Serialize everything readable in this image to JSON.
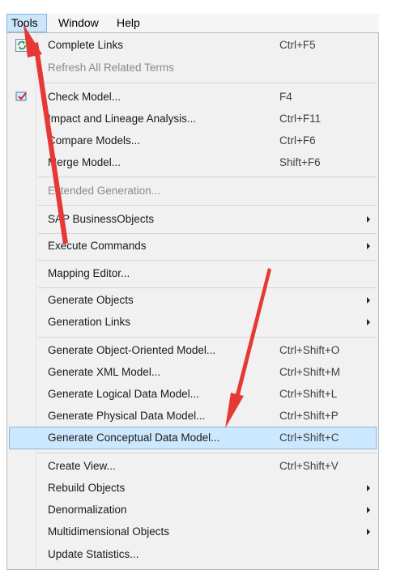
{
  "menubar": {
    "tools": "Tools",
    "window": "Window",
    "help": "Help"
  },
  "menu": {
    "complete_links": {
      "label": "Complete Links",
      "shortcut": "Ctrl+F5",
      "icon": "refresh-icon"
    },
    "refresh_related_terms": {
      "label": "Refresh All Related Terms"
    },
    "check_model": {
      "label": "Check Model...",
      "shortcut": "F4",
      "icon": "check-model-icon"
    },
    "impact_lineage": {
      "label": "Impact and Lineage Analysis...",
      "shortcut": "Ctrl+F11"
    },
    "compare_models": {
      "label": "Compare Models...",
      "shortcut": "Ctrl+F6"
    },
    "merge_model": {
      "label": "Merge Model...",
      "shortcut": "Shift+F6"
    },
    "extended_generation": {
      "label": "Extended Generation..."
    },
    "sap_businessobjects": {
      "label": "SAP BusinessObjects"
    },
    "execute_commands": {
      "label": "Execute Commands"
    },
    "mapping_editor": {
      "label": "Mapping Editor..."
    },
    "generate_objects": {
      "label": "Generate Objects"
    },
    "generation_links": {
      "label": "Generation Links"
    },
    "generate_oom": {
      "label": "Generate Object-Oriented Model...",
      "shortcut": "Ctrl+Shift+O"
    },
    "generate_xml": {
      "label": "Generate XML Model...",
      "shortcut": "Ctrl+Shift+M"
    },
    "generate_ldm": {
      "label": "Generate Logical Data Model...",
      "shortcut": "Ctrl+Shift+L"
    },
    "generate_pdm": {
      "label": "Generate Physical Data Model...",
      "shortcut": "Ctrl+Shift+P"
    },
    "generate_cdm": {
      "label": "Generate Conceptual Data Model...",
      "shortcut": "Ctrl+Shift+C"
    },
    "create_view": {
      "label": "Create View...",
      "shortcut": "Ctrl+Shift+V"
    },
    "rebuild_objects": {
      "label": "Rebuild Objects"
    },
    "denormalization": {
      "label": "Denormalization"
    },
    "multidimensional_objects": {
      "label": "Multidimensional Objects"
    },
    "update_statistics": {
      "label": "Update Statistics..."
    }
  },
  "colors": {
    "annotation_arrow": "#e53935",
    "selected_background": "#cce8ff",
    "selected_border": "#8ab7dd"
  }
}
